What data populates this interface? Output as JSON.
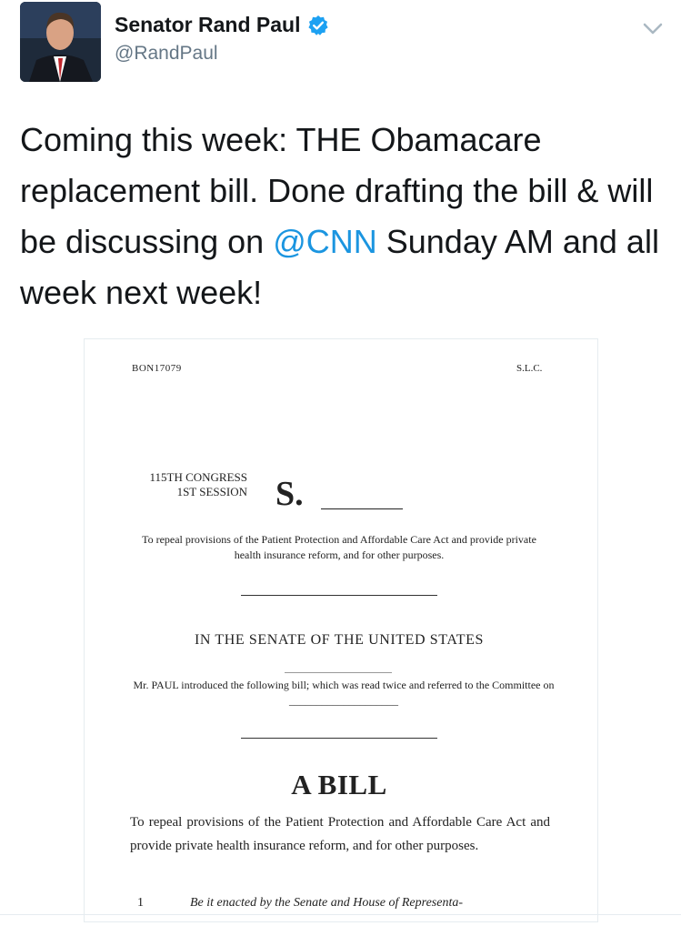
{
  "header": {
    "display_name": "Senator Rand Paul",
    "handle": "@RandPaul",
    "avatar_icon": "avatar-photo",
    "verified_icon": "verified-badge-icon",
    "menu_icon": "chevron-down-icon"
  },
  "tweet": {
    "text_before": "Coming this week: THE Obamacare replacement bill. Done drafting the bill & will be discussing on ",
    "mention": "@CNN",
    "text_after": " Sunday AM and all week next week!"
  },
  "document": {
    "id": "BON17079",
    "slc": "S.L.C.",
    "congress_line1": "115TH CONGRESS",
    "congress_line2": "1ST SESSION",
    "bill_prefix": "S.",
    "short_purpose": "To repeal provisions of the Patient Protection and Affordable Care Act and provide private health insurance reform, and for other purposes.",
    "senate_heading": "IN THE SENATE OF THE UNITED STATES",
    "introduction": "Mr. PAUL introduced the following bill; which was read twice and referred to the Committee on ____________________",
    "bill_title": "A BILL",
    "long_purpose": "To repeal provisions of the Patient Protection and Affordable Care Act and provide private health insurance reform, and for other purposes.",
    "line_number": "1",
    "enacting_clause": "Be it enacted by the Senate and House of Representa-"
  },
  "colors": {
    "link": "#1b95e0",
    "verified": "#1da1f2",
    "secondary_text": "#657786"
  }
}
